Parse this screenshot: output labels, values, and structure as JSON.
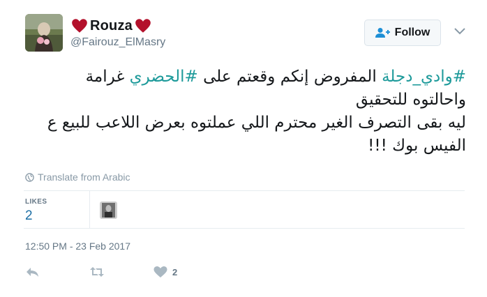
{
  "user": {
    "display_name": "Rouza",
    "handle": "@Fairouz_ElMasry"
  },
  "follow": {
    "label": "Follow"
  },
  "tweet": {
    "line1": {
      "hashtag1": "#وادي_دجلة",
      "text1": " المفروض إنكم وقعتم على ",
      "hashtag2": "#الحضري",
      "text2": " غرامة"
    },
    "line2": "واحالتوه للتحقيق",
    "line3": "ليه بقى التصرف الغير محترم اللي عملتوه بعرض اللاعب للبيع ع",
    "line4": "الفيس بوك !!!"
  },
  "translate": {
    "label": "Translate from Arabic",
    "icon": "globe-icon"
  },
  "stats": {
    "likes_label": "LIKES",
    "likes_count": "2"
  },
  "timestamp": "12:50 PM - 23 Feb 2017",
  "actions": {
    "like_count": "2"
  },
  "colors": {
    "hashtag": "#1d9a9a",
    "link": "#1d6fa5",
    "muted": "#657786",
    "heart": "#b3102b"
  }
}
